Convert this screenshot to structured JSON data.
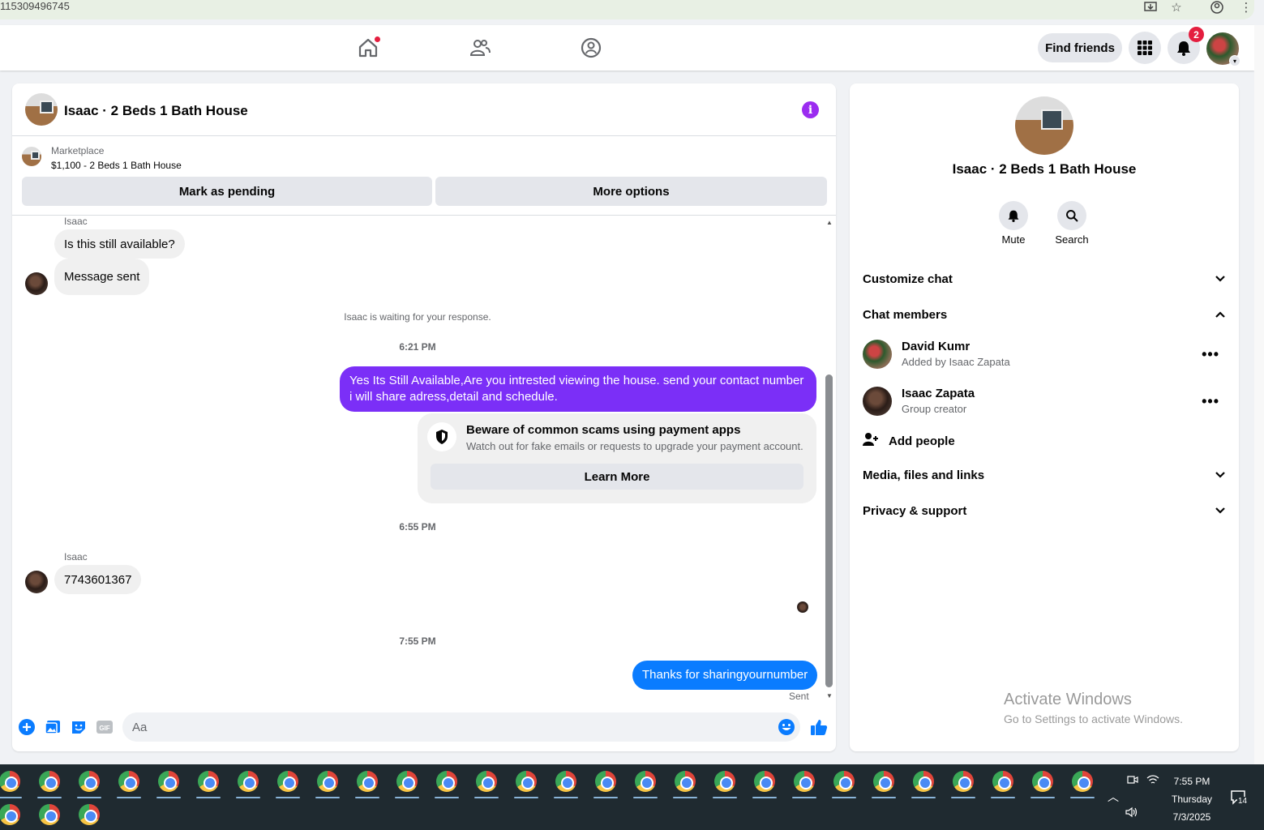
{
  "browser": {
    "url_fragment": "115309496745"
  },
  "topnav": {
    "find_friends": "Find friends",
    "notification_count": "2"
  },
  "chat": {
    "title": "Isaac · 2 Beds 1 Bath House",
    "marketplace": {
      "label": "Marketplace",
      "listing": "$1,100 - 2 Beds 1 Bath House",
      "mark_pending": "Mark as pending",
      "more_options": "More options"
    },
    "messages": {
      "sender1": "Isaac",
      "msg1": "Is this still available?",
      "msg2": "Message sent",
      "waiting": "Isaac is waiting for your response.",
      "time1": "6:21 PM",
      "out1": "Yes Its Still Available,Are you intrested viewing the house. send your contact number i will share adress,detail and schedule.",
      "scam_title": "Beware of common scams using payment apps",
      "scam_body": "Watch out for fake emails or requests to upgrade your payment account.",
      "learn_more": "Learn More",
      "time2": "6:55 PM",
      "sender2": "Isaac",
      "msg3": "7743601367",
      "time3": "7:55 PM",
      "out2": "Thanks for sharingyournumber",
      "sent": "Sent"
    },
    "composer": {
      "placeholder": "Aa"
    }
  },
  "info": {
    "title": "Isaac · 2 Beds 1 Bath House",
    "mute": "Mute",
    "search": "Search",
    "customize": "Customize chat",
    "members_header": "Chat members",
    "members": [
      {
        "name": "David Kumr",
        "sub": "Added by Isaac Zapata"
      },
      {
        "name": "Isaac Zapata",
        "sub": "Group creator"
      }
    ],
    "add_people": "Add people",
    "media": "Media, files and links",
    "privacy": "Privacy & support"
  },
  "watermark": {
    "line1": "Activate Windows",
    "line2": "Go to Settings to activate Windows."
  },
  "taskbar": {
    "time": "7:55 PM",
    "day": "Thursday",
    "date": "7/3/2025",
    "notifications": "14"
  },
  "colors": {
    "accent_purple": "#7b2ff7",
    "messenger_blue": "#0a7cff",
    "fb_blue": "#1877f2",
    "badge_red": "#e41e3f"
  }
}
